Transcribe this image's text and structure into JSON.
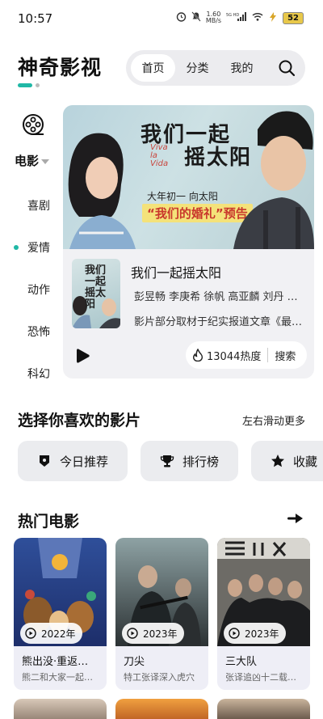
{
  "status": {
    "time": "10:57",
    "net_speed_value": "1.60",
    "net_speed_unit": "MB/s",
    "network": "5G HD",
    "battery": "52"
  },
  "header": {
    "app_title": "神奇影视",
    "nav_tabs": [
      "首页",
      "分类",
      "我的"
    ],
    "active_tab": "首页",
    "search_icon": "search-icon"
  },
  "sidebar": {
    "current_category": "电影",
    "categories": [
      "喜剧",
      "爱情",
      "动作",
      "恐怖",
      "科幻"
    ],
    "active_category": "爱情"
  },
  "featured": {
    "banner_title": "我们一起摇太阳",
    "banner_title_line1": "我们一起",
    "banner_title_line2": "摇太阳",
    "banner_viva": "Viva la Vida",
    "banner_sub1": "大年初一 向太阳",
    "banner_sub2": "“我们的婚礼”预告",
    "name": "我们一起摇太阳",
    "cast": "彭昱畅 李庚希 徐帆 高亚麟 刘丹 …",
    "description": "影片部分取材于纪实报道文章《最…",
    "heat": "13044热度",
    "search_label": "搜索",
    "poster_thumb_title": "我们一起摇太阳"
  },
  "choose": {
    "title": "选择你喜欢的影片",
    "more": "左右滑动更多",
    "chips": [
      {
        "label": "今日推荐",
        "icon": "badge-icon"
      },
      {
        "label": "排行榜",
        "icon": "trophy-icon"
      },
      {
        "label": "收藏",
        "icon": "star-icon"
      }
    ]
  },
  "hot": {
    "title": "热门电影",
    "movies": [
      {
        "year": "2022年",
        "name": "熊出没·重返…",
        "desc": "熊二和大家一起…"
      },
      {
        "year": "2023年",
        "name": "刀尖",
        "desc": "特工张译深入虎穴"
      },
      {
        "year": "2023年",
        "name": "三大队",
        "desc": "张译追凶十二载…"
      }
    ]
  },
  "colors": {
    "accent": "#20b8a6",
    "nav_bg": "#ececef",
    "card_bg": "#f1f1f4",
    "chip_bg": "#ebecef"
  }
}
